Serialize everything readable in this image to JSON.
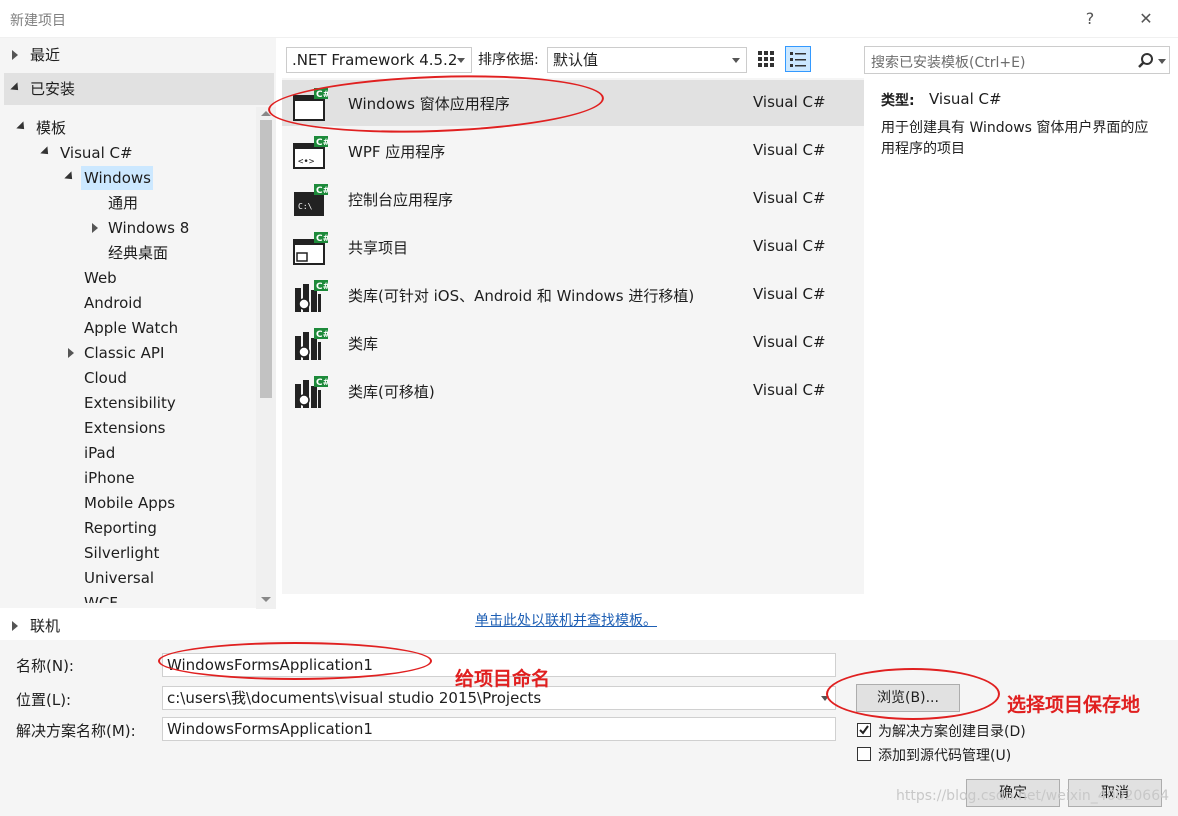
{
  "window": {
    "title": "新建项目",
    "help": "?",
    "close": "✕"
  },
  "tree": {
    "recent": "最近",
    "installed": "已安装",
    "templates": "模板",
    "visual_csharp": "Visual C#",
    "windows": "Windows",
    "children_windows": [
      "通用",
      "Windows 8",
      "经典桌面"
    ],
    "items": [
      "Web",
      "Android",
      "Apple Watch",
      "Classic API",
      "Cloud",
      "Extensibility",
      "Extensions",
      "iPad",
      "iPhone",
      "Mobile Apps",
      "Reporting",
      "Silverlight",
      "Universal",
      "WCF"
    ],
    "online": "联机"
  },
  "toolbar": {
    "framework": ".NET Framework 4.5.2",
    "sort_label": "排序依据:",
    "sort_value": "默认值"
  },
  "search": {
    "placeholder": "搜索已安装模板(Ctrl+E)"
  },
  "templates": [
    {
      "name": "Windows 窗体应用程序",
      "lang": "Visual C#"
    },
    {
      "name": "WPF 应用程序",
      "lang": "Visual C#"
    },
    {
      "name": "控制台应用程序",
      "lang": "Visual C#"
    },
    {
      "name": "共享项目",
      "lang": "Visual C#"
    },
    {
      "name": "类库(可针对 iOS、Android 和 Windows 进行移植)",
      "lang": "Visual C#"
    },
    {
      "name": "类库",
      "lang": "Visual C#"
    },
    {
      "name": "类库(可移植)",
      "lang": "Visual C#"
    }
  ],
  "description": {
    "type_label": "类型:",
    "type_value": "Visual C#",
    "text": "用于创建具有 Windows 窗体用户界面的应用程序的项目"
  },
  "online_link": "单击此处以联机并查找模板。",
  "form": {
    "name_label": "名称(N):",
    "name_value": "WindowsFormsApplication1",
    "location_label": "位置(L):",
    "location_value": "c:\\users\\我\\documents\\visual studio 2015\\Projects",
    "solution_label": "解决方案名称(M):",
    "solution_value": "WindowsFormsApplication1",
    "browse": "浏览(B)...",
    "create_dir": "为解决方案创建目录(D)",
    "add_source": "添加到源代码管理(U)",
    "ok": "确定",
    "cancel": "取消"
  },
  "annotations": {
    "name_note": "给项目命名",
    "location_note": "选择项目保存地"
  },
  "watermark": "https://blog.csdn.net/weixin_40020664",
  "colors": {
    "annotation": "#e02020",
    "selection": "#cce8ff",
    "link": "#1e5fb4"
  }
}
